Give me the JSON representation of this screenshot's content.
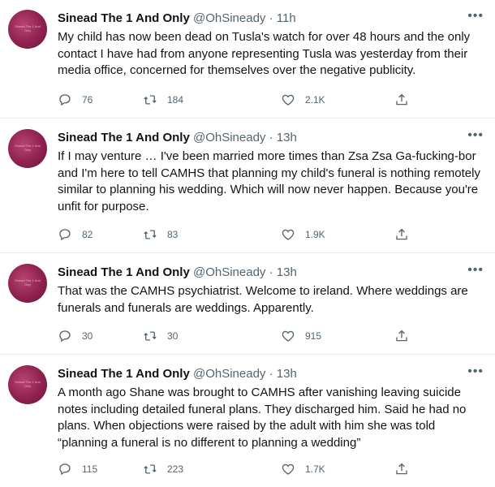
{
  "avatar_text": "Sinead The 1 And Only",
  "tweets": [
    {
      "name": "Sinead The 1 And Only",
      "handle": "@OhSineady",
      "sep": "·",
      "time": "11h",
      "more": "•••",
      "text": "My child has now been dead on Tusla's watch for over 48 hours and the only contact I have had from anyone representing Tusla was yesterday from their media office, concerned for themselves over the negative publicity.",
      "replies": "76",
      "retweets": "184",
      "likes": "2.1K"
    },
    {
      "name": "Sinead The 1 And Only",
      "handle": "@OhSineady",
      "sep": "·",
      "time": "13h",
      "more": "•••",
      "text": "If I may venture … I've been married more times than Zsa Zsa Ga-fucking-bor and I'm here to tell CAMHS that planning my child's funeral is nothing remotely similar to planning his wedding. Which will now never happen. Because you're unfit for purpose.",
      "replies": "82",
      "retweets": "83",
      "likes": "1.9K"
    },
    {
      "name": "Sinead The 1 And Only",
      "handle": "@OhSineady",
      "sep": "·",
      "time": "13h",
      "more": "•••",
      "text": "That was the CAMHS psychiatrist.  Welcome to ireland. Where weddings are funerals and funerals are weddings. Apparently.",
      "replies": "30",
      "retweets": "30",
      "likes": "915"
    },
    {
      "name": "Sinead The 1 And Only",
      "handle": "@OhSineady",
      "sep": "·",
      "time": "13h",
      "more": "•••",
      "text": "A month ago Shane was brought to CAMHS after vanishing leaving suicide notes including detailed funeral plans. They discharged him.  Said he had no plans.  When objections were raised by the adult with him she was told “planning a funeral is no different to planning a wedding”",
      "replies": "115",
      "retweets": "223",
      "likes": "1.7K"
    }
  ]
}
